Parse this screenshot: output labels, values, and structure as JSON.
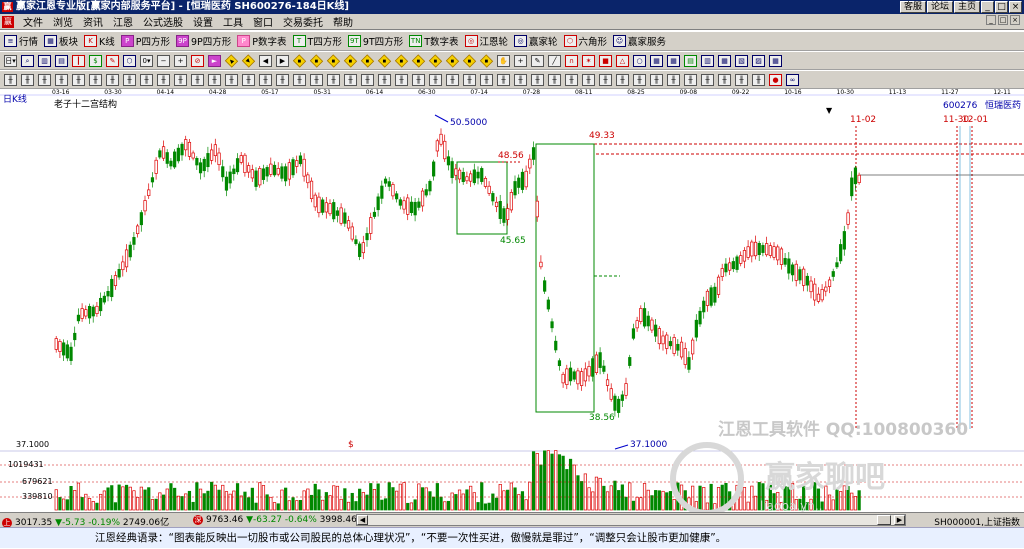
{
  "window": {
    "logo": "赢",
    "title": "赢家江恩专业版[赢家内部服务平台] - [恒瑞医药  SH600276-184日K线]",
    "buttons": [
      "客服",
      "论坛",
      "主页",
      "_",
      "□",
      "×"
    ]
  },
  "menu": {
    "logo": "赢",
    "items": [
      "文件",
      "浏览",
      "资讯",
      "江恩",
      "公式选股",
      "设置",
      "工具",
      "窗口",
      "交易委托",
      "帮助"
    ],
    "mini": [
      "_",
      "□",
      "×"
    ]
  },
  "toolbar1": {
    "items": [
      {
        "icon": "list-icon",
        "label": "行情",
        "cls": "b",
        "glyph": "≡"
      },
      {
        "icon": "grid-icon",
        "label": "板块",
        "cls": "b",
        "glyph": "▦"
      },
      {
        "icon": "candlestick-icon",
        "label": "K线",
        "cls": "r",
        "glyph": "K"
      },
      {
        "icon": "p-square-icon",
        "label": "P四方形",
        "cls": "p",
        "glyph": "P"
      },
      {
        "icon": "9p-square-icon",
        "label": "9P四方形",
        "cls": "p",
        "glyph": "9P"
      },
      {
        "icon": "p-number-icon",
        "label": "P数字表",
        "cls": "pink",
        "glyph": "P"
      },
      {
        "icon": "t-square-icon",
        "label": "T四方形",
        "cls": "g",
        "glyph": "T"
      },
      {
        "icon": "9t-square-icon",
        "label": "9T四方形",
        "cls": "g",
        "glyph": "9T"
      },
      {
        "icon": "t-number-icon",
        "label": "T数字表",
        "cls": "g",
        "glyph": "TN"
      },
      {
        "icon": "gann-wheel-icon",
        "label": "江恩轮",
        "cls": "r",
        "glyph": "◎"
      },
      {
        "icon": "winner-wheel-icon",
        "label": "赢家轮",
        "cls": "b",
        "glyph": "◎"
      },
      {
        "icon": "hexagon-icon",
        "label": "六角形",
        "cls": "r",
        "glyph": "⬡"
      },
      {
        "icon": "service-icon",
        "label": "赢家服务",
        "cls": "b",
        "glyph": "☺"
      }
    ]
  },
  "toolbar2": {
    "items": [
      {
        "icon": "day-period-icon",
        "glyph": "日▾",
        "cls": ""
      },
      {
        "icon": "zoom-icon",
        "glyph": "⌕",
        "cls": "b"
      },
      {
        "icon": "chart-icon",
        "glyph": "▥",
        "cls": "b"
      },
      {
        "icon": "calendar-icon",
        "glyph": "▤",
        "cls": "b"
      },
      {
        "icon": "bars-icon",
        "glyph": "┃",
        "cls": "r"
      },
      {
        "icon": "finance-icon",
        "glyph": "$",
        "cls": "g"
      },
      {
        "icon": "tools-icon",
        "glyph": "✎",
        "cls": "r"
      },
      {
        "icon": "draw-icon",
        "glyph": "⬡",
        "cls": "b"
      },
      {
        "icon": "number-icon",
        "glyph": "0▾",
        "cls": ""
      },
      {
        "icon": "subtract-icon",
        "glyph": "−",
        "cls": ""
      },
      {
        "icon": "plus-icon",
        "glyph": "+",
        "cls": ""
      },
      {
        "icon": "ban-icon",
        "glyph": "⊘",
        "cls": "r"
      },
      {
        "icon": "flag-icon",
        "glyph": "►",
        "cls": "p"
      },
      {
        "icon": "prev-icon",
        "glyph": "◀",
        "cls": "y"
      },
      {
        "icon": "next-icon",
        "glyph": "▶",
        "cls": "y"
      },
      {
        "icon": "arrow-left-icon",
        "glyph": "◀",
        "cls": ""
      },
      {
        "icon": "arrow-right-icon",
        "glyph": "▶",
        "cls": ""
      },
      {
        "icon": "play-icon",
        "glyph": "◆",
        "cls": "y"
      },
      {
        "icon": "diamond-icon",
        "glyph": "◆",
        "cls": "y"
      },
      {
        "icon": "diamond2-icon",
        "glyph": "◆",
        "cls": "y"
      },
      {
        "icon": "diamond3-icon",
        "glyph": "◆",
        "cls": "y"
      },
      {
        "icon": "diamond4-icon",
        "glyph": "◆",
        "cls": "y"
      },
      {
        "icon": "diamond5-icon",
        "glyph": "◆",
        "cls": "y"
      },
      {
        "icon": "diamond6-icon",
        "glyph": "◆",
        "cls": "y"
      },
      {
        "icon": "diamond7-icon",
        "glyph": "◆",
        "cls": "y"
      },
      {
        "icon": "diamond8-icon",
        "glyph": "◆",
        "cls": "y"
      },
      {
        "icon": "diamond9-icon",
        "glyph": "◆",
        "cls": "y"
      },
      {
        "icon": "diamond10-icon",
        "glyph": "◆",
        "cls": "y"
      },
      {
        "icon": "diamond11-icon",
        "glyph": "◆",
        "cls": "y"
      },
      {
        "icon": "hand-icon",
        "glyph": "✋",
        "cls": ""
      },
      {
        "icon": "crosshair-icon",
        "glyph": "+",
        "cls": ""
      },
      {
        "icon": "pencil-icon",
        "glyph": "✎",
        "cls": ""
      },
      {
        "icon": "line-icon",
        "glyph": "╱",
        "cls": ""
      },
      {
        "icon": "magnet-icon",
        "glyph": "∩",
        "cls": "r"
      },
      {
        "icon": "gann-fan-icon",
        "glyph": "✶",
        "cls": "r"
      },
      {
        "icon": "square-icon",
        "glyph": "■",
        "cls": "r"
      },
      {
        "icon": "tri-icon",
        "glyph": "△",
        "cls": "r"
      },
      {
        "icon": "circle-icon",
        "glyph": "○",
        "cls": "b"
      },
      {
        "icon": "table-icon",
        "glyph": "▦",
        "cls": "b"
      },
      {
        "icon": "grid2-icon",
        "glyph": "▦",
        "cls": "b"
      },
      {
        "icon": "grid3-icon",
        "glyph": "▤",
        "cls": "g"
      },
      {
        "icon": "grid4-icon",
        "glyph": "▥",
        "cls": "b"
      },
      {
        "icon": "grid5-icon",
        "glyph": "▦",
        "cls": "b"
      },
      {
        "icon": "grid6-icon",
        "glyph": "▧",
        "cls": "b"
      },
      {
        "icon": "grid7-icon",
        "glyph": "▨",
        "cls": "b"
      },
      {
        "icon": "grid8-icon",
        "glyph": "▦",
        "cls": "b"
      }
    ]
  },
  "toolbar3": {
    "items": [
      {
        "icon": "chart-type-icon",
        "glyph": "╫",
        "cls": ""
      },
      {
        "icon": "t1-icon",
        "glyph": "╫",
        "cls": ""
      },
      {
        "icon": "t2-icon",
        "glyph": "╫",
        "cls": ""
      },
      {
        "icon": "t3-icon",
        "glyph": "╫",
        "cls": ""
      },
      {
        "icon": "t4-icon",
        "glyph": "╫",
        "cls": ""
      },
      {
        "icon": "t5-icon",
        "glyph": "╫",
        "cls": ""
      },
      {
        "icon": "t6-icon",
        "glyph": "╫",
        "cls": ""
      },
      {
        "icon": "t7-icon",
        "glyph": "╫",
        "cls": ""
      },
      {
        "icon": "t8-icon",
        "glyph": "╫",
        "cls": ""
      },
      {
        "icon": "t9-icon",
        "glyph": "╫",
        "cls": ""
      },
      {
        "icon": "t10-icon",
        "glyph": "╫",
        "cls": ""
      },
      {
        "icon": "t11-icon",
        "glyph": "╫",
        "cls": ""
      },
      {
        "icon": "t12-icon",
        "glyph": "╫",
        "cls": ""
      },
      {
        "icon": "t13-icon",
        "glyph": "╫",
        "cls": ""
      },
      {
        "icon": "t14-icon",
        "glyph": "╫",
        "cls": ""
      },
      {
        "icon": "t15-icon",
        "glyph": "╫",
        "cls": ""
      },
      {
        "icon": "t16-icon",
        "glyph": "╫",
        "cls": ""
      },
      {
        "icon": "t17-icon",
        "glyph": "╫",
        "cls": ""
      },
      {
        "icon": "t18-icon",
        "glyph": "╫",
        "cls": ""
      },
      {
        "icon": "t19-icon",
        "glyph": "╫",
        "cls": ""
      },
      {
        "icon": "t20-icon",
        "glyph": "╫",
        "cls": ""
      },
      {
        "icon": "t21-icon",
        "glyph": "╫",
        "cls": ""
      },
      {
        "icon": "t22-icon",
        "glyph": "╫",
        "cls": ""
      },
      {
        "icon": "t23-icon",
        "glyph": "╫",
        "cls": ""
      },
      {
        "icon": "t24-icon",
        "glyph": "╫",
        "cls": ""
      },
      {
        "icon": "t25-icon",
        "glyph": "╫",
        "cls": ""
      },
      {
        "icon": "t26-icon",
        "glyph": "╫",
        "cls": ""
      },
      {
        "icon": "t27-icon",
        "glyph": "╫",
        "cls": ""
      },
      {
        "icon": "t28-icon",
        "glyph": "╫",
        "cls": ""
      },
      {
        "icon": "t29-icon",
        "glyph": "╫",
        "cls": ""
      },
      {
        "icon": "t30-icon",
        "glyph": "╫",
        "cls": ""
      },
      {
        "icon": "t31-icon",
        "glyph": "╫",
        "cls": ""
      },
      {
        "icon": "t32-icon",
        "glyph": "╫",
        "cls": ""
      },
      {
        "icon": "t33-icon",
        "glyph": "╫",
        "cls": ""
      },
      {
        "icon": "t34-icon",
        "glyph": "╫",
        "cls": ""
      },
      {
        "icon": "t35-icon",
        "glyph": "╫",
        "cls": ""
      },
      {
        "icon": "t36-icon",
        "glyph": "╫",
        "cls": ""
      },
      {
        "icon": "t37-icon",
        "glyph": "╫",
        "cls": ""
      },
      {
        "icon": "t38-icon",
        "glyph": "╫",
        "cls": ""
      },
      {
        "icon": "t39-icon",
        "glyph": "╫",
        "cls": ""
      },
      {
        "icon": "t40-icon",
        "glyph": "╫",
        "cls": ""
      },
      {
        "icon": "t41-icon",
        "glyph": "╫",
        "cls": ""
      },
      {
        "icon": "t42-icon",
        "glyph": "╫",
        "cls": ""
      },
      {
        "icon": "t43-icon",
        "glyph": "╫",
        "cls": ""
      },
      {
        "icon": "t44-icon",
        "glyph": "╫",
        "cls": ""
      },
      {
        "icon": "color-icon",
        "glyph": "●",
        "cls": "r"
      },
      {
        "icon": "infinity-icon",
        "glyph": "∞",
        "cls": "b"
      }
    ]
  },
  "chart_data": {
    "type": "candlestick",
    "period_label": "日K线",
    "overlay_label": "老子十二宫结构",
    "stock_code": "600276",
    "stock_name": "恒瑞医药",
    "date_ticks": [
      "03-16",
      "03-30",
      "04-14",
      "04-28",
      "05-17",
      "05-31",
      "06-14",
      "06-30",
      "07-14",
      "07-28",
      "08-11",
      "08-25",
      "09-08",
      "09-22",
      "10-16",
      "10-30",
      "11-13",
      "11-27",
      "12-11"
    ],
    "date_labels_top": [
      "11-02",
      "11-30",
      "12-01"
    ],
    "price_labels": [
      "50.5000",
      "49.33",
      "48.56",
      "45.65",
      "38.56",
      "37.1000"
    ],
    "y_axis_price": "37.1000",
    "volume_ticks": [
      "1019431",
      "679621",
      "339810"
    ],
    "dollar_marker": "$",
    "watermark1": "江恩工具软件  QQ:100800360",
    "watermark2": "赢家聊吧",
    "watermark3": "liaoba.yn.."
  },
  "index_bar": {
    "sh_value": "3017.35",
    "sh_change": "-5.73",
    "sh_pct": "-0.19%",
    "sh_amount": "2749.06亿",
    "sz_value": "9763.46",
    "sz_change": "-63.27",
    "sz_pct": "-0.64%",
    "sz_amount": "3998.46",
    "right_index": "SH000001,上证指数"
  },
  "status": {
    "text": "江恩经典语录：“图表能反映出一切股市或公司股民的总体心理状况”，“不要一次性买进，傲慢就是罪过”，“调整只会让股市更加健康”。"
  }
}
